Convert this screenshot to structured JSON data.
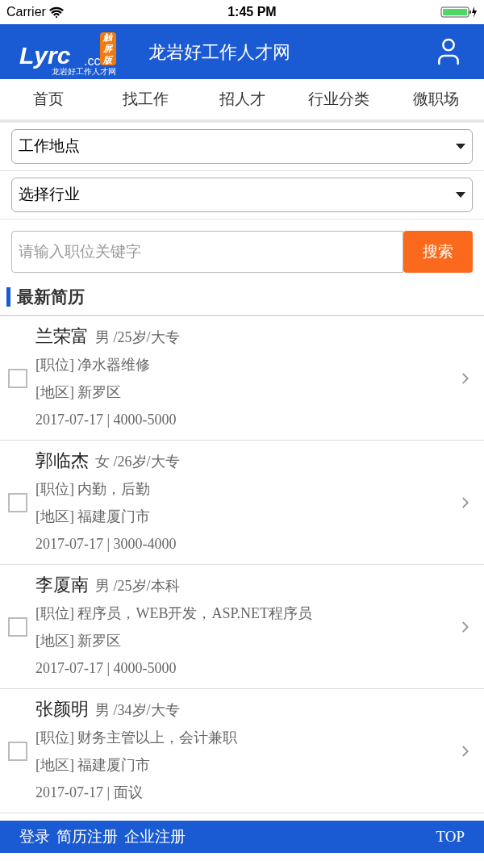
{
  "status_bar": {
    "carrier": "Carrier",
    "time": "1:45 PM"
  },
  "header": {
    "logo": {
      "main": "Lyrc",
      "suffix": ".cc",
      "badge": "触屏版",
      "tagline": "龙岩好工作人才网"
    },
    "title": "龙岩好工作人才网"
  },
  "nav": [
    {
      "label": "首页"
    },
    {
      "label": "找工作"
    },
    {
      "label": "招人才"
    },
    {
      "label": "行业分类"
    },
    {
      "label": "微职场"
    }
  ],
  "filters": [
    {
      "value": "工作地点"
    },
    {
      "value": "选择行业"
    }
  ],
  "search": {
    "placeholder": "请输入职位关键字",
    "button": "搜索"
  },
  "section_title": "最新简历",
  "resumes": [
    {
      "name": "兰荣富",
      "meta": "男 /25岁/大专",
      "position": "[职位] 净水器维修",
      "area": "[地区] 新罗区",
      "date_salary": "2017-07-17 | 4000-5000",
      "checked": false
    },
    {
      "name": "郭临杰",
      "meta": "女 /26岁/大专",
      "position": "[职位] 内勤，后勤",
      "area": "[地区] 福建厦门市",
      "date_salary": "2017-07-17 | 3000-4000",
      "checked": false
    },
    {
      "name": "李厦南",
      "meta": "男 /25岁/本科",
      "position": "[职位] 程序员，WEB开发，ASP.NET程序员",
      "area": "[地区] 新罗区",
      "date_salary": "2017-07-17 | 4000-5000",
      "checked": false
    },
    {
      "name": "张颜明",
      "meta": "男 /34岁/大专",
      "position": "[职位] 财务主管以上，会计兼职",
      "area": "[地区] 福建厦门市",
      "date_salary": "2017-07-17 | 面议",
      "checked": false
    }
  ],
  "footer": {
    "links": [
      "登录",
      "简历注册",
      "企业注册"
    ],
    "top": "TOP"
  }
}
